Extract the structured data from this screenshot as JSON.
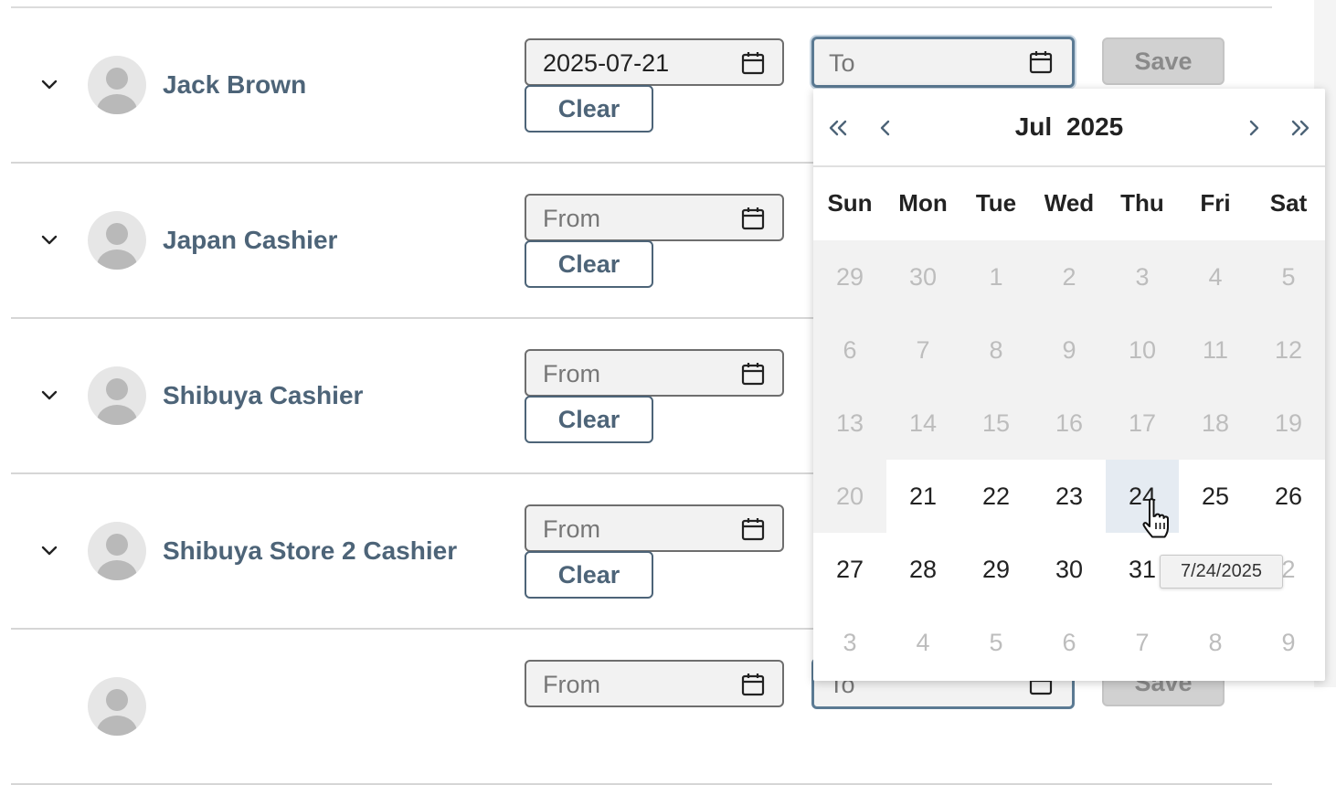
{
  "users": [
    {
      "name": "Jack Brown",
      "from_value": "2025-07-21",
      "clear_label": "Clear",
      "to_placeholder": "To",
      "save_label": "Save"
    },
    {
      "name": "Japan Cashier",
      "from_value": "From",
      "clear_label": "Clear"
    },
    {
      "name": "Shibuya Cashier",
      "from_value": "From",
      "clear_label": "Clear"
    },
    {
      "name": "Shibuya Store 2 Cashier",
      "from_value": "From",
      "clear_label": "Clear"
    },
    {
      "name": "",
      "from_value": "From",
      "to_placeholder": "To",
      "save_label": "Save"
    }
  ],
  "calendar": {
    "month": "Jul",
    "year": "2025",
    "weekdays": [
      "Sun",
      "Mon",
      "Tue",
      "Wed",
      "Thu",
      "Fri",
      "Sat"
    ],
    "weeks": [
      [
        "29",
        "30",
        "1",
        "2",
        "3",
        "4",
        "5"
      ],
      [
        "6",
        "7",
        "8",
        "9",
        "10",
        "11",
        "12"
      ],
      [
        "13",
        "14",
        "15",
        "16",
        "17",
        "18",
        "19"
      ],
      [
        "20",
        "21",
        "22",
        "23",
        "24",
        "25",
        "26"
      ],
      [
        "27",
        "28",
        "29",
        "30",
        "31",
        "1",
        "2"
      ],
      [
        "3",
        "4",
        "5",
        "6",
        "7",
        "8",
        "9"
      ]
    ],
    "hovered_day": "24",
    "tooltip": "7/24/2025"
  },
  "colors": {
    "accent": "#4d6478",
    "focus_border": "#5b7a93",
    "disabled_day_bg": "#f2f2f2",
    "hover_day_bg": "#e5ebf2"
  },
  "icons": {
    "expand": "chevron-down-icon",
    "date": "calendar-icon",
    "prev_year": "double-chevron-left-icon",
    "prev_month": "chevron-left-icon",
    "next_month": "chevron-right-icon",
    "next_year": "double-chevron-right-icon",
    "cursor": "hand-pointer-icon"
  }
}
